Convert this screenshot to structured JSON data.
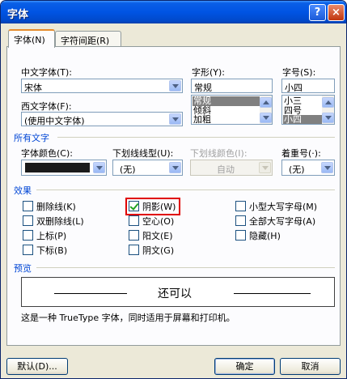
{
  "window": {
    "title": "字体",
    "help_label": "?",
    "close_label": "×"
  },
  "tabs": [
    {
      "label": "字体(N)"
    },
    {
      "label": "字符间距(R)"
    }
  ],
  "font": {
    "cn_label": "中文字体(T):",
    "cn_value": "宋体",
    "west_label": "西文字体(F):",
    "west_value": "(使用中文字体)",
    "style_label": "字形(Y):",
    "style_value": "常规",
    "style_options": [
      "常规",
      "倾斜",
      "加粗"
    ],
    "size_label": "字号(S):",
    "size_value": "小四",
    "size_options": [
      "小三",
      "四号",
      "小四"
    ]
  },
  "all_text": {
    "section": "所有文字",
    "color_label": "字体颜色(C):",
    "color_swatch": "#1a1a1a",
    "underline_label": "下划线线型(U):",
    "underline_value": "(无)",
    "uline_color_label": "下划线颜色(I):",
    "uline_color_value": "自动",
    "emphasis_label": "着重号(·):",
    "emphasis_value": "(无)"
  },
  "effects": {
    "section": "效果",
    "items": [
      {
        "label": "删除线(K)",
        "checked": false
      },
      {
        "label": "双删除线(L)",
        "checked": false
      },
      {
        "label": "上标(P)",
        "checked": false
      },
      {
        "label": "下标(B)",
        "checked": false
      },
      {
        "label": "阴影(W)",
        "checked": true
      },
      {
        "label": "空心(O)",
        "checked": false
      },
      {
        "label": "阳文(E)",
        "checked": false
      },
      {
        "label": "阴文(G)",
        "checked": false
      },
      {
        "label": "小型大写字母(M)",
        "checked": false
      },
      {
        "label": "全部大写字母(A)",
        "checked": false
      },
      {
        "label": "隐藏(H)",
        "checked": false
      }
    ]
  },
  "preview": {
    "section": "预览",
    "text": "还可以",
    "note": "这是一种 TrueType 字体，同时适用于屏幕和打印机。"
  },
  "buttons": {
    "default": "默认(D)...",
    "ok": "确定",
    "cancel": "取消"
  }
}
